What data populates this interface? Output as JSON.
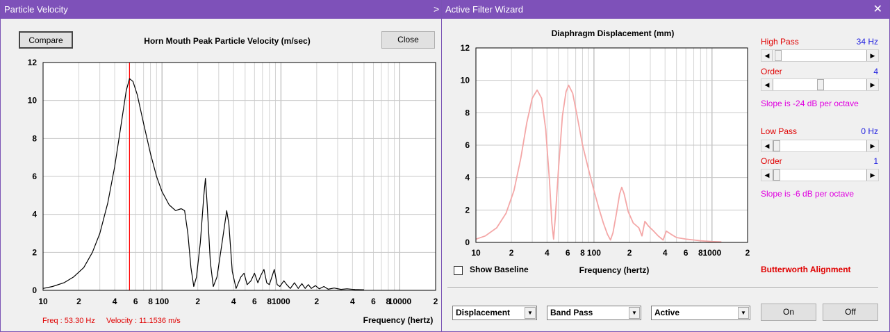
{
  "left_window": {
    "title": "Particle Velocity",
    "compare_label": "Compare",
    "close_label": "Close",
    "status_freq": "Freq : 53.30 Hz",
    "status_velocity": "Velocity : 11.1536 m/s"
  },
  "right_window": {
    "title": "Active Filter Wizard",
    "high_pass_label": "High Pass",
    "high_pass_value": "34 Hz",
    "hp_order_label": "Order",
    "hp_order_value": "4",
    "hp_slope_text": "Slope is -24 dB per octave",
    "low_pass_label": "Low Pass",
    "low_pass_value": "0 Hz",
    "lp_order_label": "Order",
    "lp_order_value": "1",
    "lp_slope_text": "Slope is -6 dB per octave",
    "show_baseline_label": "Show Baseline",
    "alignment_text": "Butterworth Alignment",
    "select_mode": "Displacement",
    "select_filter": "Band Pass",
    "select_type": "Active",
    "on_label": "On",
    "off_label": "Off"
  },
  "colors": {
    "titlebar": "#7e51b9",
    "red_label": "#e00000",
    "blue_value": "#2020e0",
    "magenta_text": "#e000e0",
    "velocity_curve": "#000000",
    "displacement_curve": "#f4a7a7",
    "marker_line": "#ff0000"
  },
  "chart_data": [
    {
      "type": "line",
      "title": "Horn Mouth Peak Particle Velocity (m/sec)",
      "xlabel": "Frequency (hertz)",
      "ylabel": "",
      "x_scale": "log",
      "xlim": [
        10,
        20000
      ],
      "ylim": [
        0,
        12
      ],
      "y_ticks": [
        "0",
        "2",
        "4",
        "6",
        "8",
        "10",
        "12"
      ],
      "x_tick_labels": [
        {
          "f": 10,
          "t": "10"
        },
        {
          "f": 20,
          "t": "2"
        },
        {
          "f": 40,
          "t": "4"
        },
        {
          "f": 60,
          "t": "6"
        },
        {
          "f": 80,
          "t": "8"
        },
        {
          "f": 100,
          "t": "100"
        },
        {
          "f": 200,
          "t": "2"
        },
        {
          "f": 400,
          "t": "4"
        },
        {
          "f": 600,
          "t": "6"
        },
        {
          "f": 800,
          "t": "8"
        },
        {
          "f": 1000,
          "t": "1000"
        },
        {
          "f": 2000,
          "t": "2"
        },
        {
          "f": 4000,
          "t": "4"
        },
        {
          "f": 6000,
          "t": "6"
        },
        {
          "f": 8000,
          "t": "8"
        },
        {
          "f": 10000,
          "t": "10000"
        },
        {
          "f": 20000,
          "t": "2"
        }
      ],
      "marker_frequency": 53.3,
      "series": [
        {
          "points": [
            [
              10,
              0.1
            ],
            [
              12,
              0.2
            ],
            [
              15,
              0.4
            ],
            [
              18,
              0.7
            ],
            [
              22,
              1.2
            ],
            [
              26,
              2.0
            ],
            [
              30,
              3.0
            ],
            [
              35,
              4.6
            ],
            [
              40,
              6.5
            ],
            [
              45,
              8.6
            ],
            [
              50,
              10.5
            ],
            [
              53.3,
              11.15
            ],
            [
              57,
              11.0
            ],
            [
              62,
              10.3
            ],
            [
              70,
              8.8
            ],
            [
              80,
              7.2
            ],
            [
              90,
              6.0
            ],
            [
              100,
              5.2
            ],
            [
              115,
              4.5
            ],
            [
              130,
              4.2
            ],
            [
              145,
              4.3
            ],
            [
              155,
              4.2
            ],
            [
              165,
              3.0
            ],
            [
              175,
              1.2
            ],
            [
              185,
              0.2
            ],
            [
              195,
              0.7
            ],
            [
              210,
              2.5
            ],
            [
              225,
              5.0
            ],
            [
              232,
              5.9
            ],
            [
              240,
              4.5
            ],
            [
              255,
              1.5
            ],
            [
              270,
              0.2
            ],
            [
              290,
              0.7
            ],
            [
              320,
              2.5
            ],
            [
              350,
              4.2
            ],
            [
              365,
              3.5
            ],
            [
              390,
              1.0
            ],
            [
              420,
              0.1
            ],
            [
              460,
              0.7
            ],
            [
              490,
              0.9
            ],
            [
              520,
              0.3
            ],
            [
              560,
              0.5
            ],
            [
              600,
              0.9
            ],
            [
              640,
              0.4
            ],
            [
              680,
              0.8
            ],
            [
              720,
              1.1
            ],
            [
              760,
              0.4
            ],
            [
              800,
              0.3
            ],
            [
              850,
              0.8
            ],
            [
              880,
              1.1
            ],
            [
              930,
              0.3
            ],
            [
              980,
              0.2
            ],
            [
              1060,
              0.5
            ],
            [
              1120,
              0.3
            ],
            [
              1200,
              0.1
            ],
            [
              1300,
              0.4
            ],
            [
              1400,
              0.1
            ],
            [
              1500,
              0.35
            ],
            [
              1600,
              0.1
            ],
            [
              1700,
              0.3
            ],
            [
              1800,
              0.1
            ],
            [
              1950,
              0.25
            ],
            [
              2100,
              0.08
            ],
            [
              2300,
              0.2
            ],
            [
              2500,
              0.06
            ],
            [
              2800,
              0.12
            ],
            [
              3200,
              0.05
            ],
            [
              3600,
              0.08
            ],
            [
              4200,
              0.04
            ],
            [
              5000,
              0.03
            ]
          ]
        }
      ]
    },
    {
      "type": "line",
      "title": "Diaphragm Displacement (mm)",
      "xlabel": "Frequency (hertz)",
      "ylabel": "",
      "x_scale": "log",
      "xlim": [
        10,
        2000
      ],
      "ylim": [
        0,
        12
      ],
      "y_ticks": [
        "0",
        "2",
        "4",
        "6",
        "8",
        "10",
        "12"
      ],
      "x_tick_labels": [
        {
          "f": 10,
          "t": "10"
        },
        {
          "f": 20,
          "t": "2"
        },
        {
          "f": 40,
          "t": "4"
        },
        {
          "f": 60,
          "t": "6"
        },
        {
          "f": 80,
          "t": "8"
        },
        {
          "f": 100,
          "t": "100"
        },
        {
          "f": 200,
          "t": "2"
        },
        {
          "f": 400,
          "t": "4"
        },
        {
          "f": 600,
          "t": "6"
        },
        {
          "f": 800,
          "t": "8"
        },
        {
          "f": 1000,
          "t": "1000"
        },
        {
          "f": 2000,
          "t": "2"
        }
      ],
      "series": [
        {
          "points": [
            [
              10,
              0.2
            ],
            [
              12,
              0.4
            ],
            [
              15,
              0.9
            ],
            [
              18,
              1.8
            ],
            [
              21,
              3.2
            ],
            [
              24,
              5.2
            ],
            [
              27,
              7.4
            ],
            [
              30,
              8.9
            ],
            [
              33,
              9.4
            ],
            [
              36,
              8.9
            ],
            [
              39,
              7.0
            ],
            [
              42,
              3.8
            ],
            [
              44,
              1.2
            ],
            [
              45.5,
              0.2
            ],
            [
              47,
              1.5
            ],
            [
              50,
              4.5
            ],
            [
              54,
              7.8
            ],
            [
              58,
              9.3
            ],
            [
              61,
              9.7
            ],
            [
              66,
              9.2
            ],
            [
              72,
              7.8
            ],
            [
              80,
              6.0
            ],
            [
              90,
              4.5
            ],
            [
              100,
              3.2
            ],
            [
              110,
              2.1
            ],
            [
              120,
              1.2
            ],
            [
              130,
              0.5
            ],
            [
              138,
              0.15
            ],
            [
              145,
              0.6
            ],
            [
              155,
              1.8
            ],
            [
              165,
              3.0
            ],
            [
              172,
              3.4
            ],
            [
              180,
              3.0
            ],
            [
              195,
              1.9
            ],
            [
              215,
              1.2
            ],
            [
              240,
              0.9
            ],
            [
              255,
              0.4
            ],
            [
              270,
              1.3
            ],
            [
              290,
              1.0
            ],
            [
              320,
              0.7
            ],
            [
              350,
              0.4
            ],
            [
              385,
              0.15
            ],
            [
              410,
              0.7
            ],
            [
              450,
              0.5
            ],
            [
              500,
              0.3
            ],
            [
              600,
              0.2
            ],
            [
              700,
              0.15
            ],
            [
              800,
              0.1
            ],
            [
              1000,
              0.05
            ],
            [
              1200,
              0.03
            ]
          ]
        }
      ]
    }
  ]
}
